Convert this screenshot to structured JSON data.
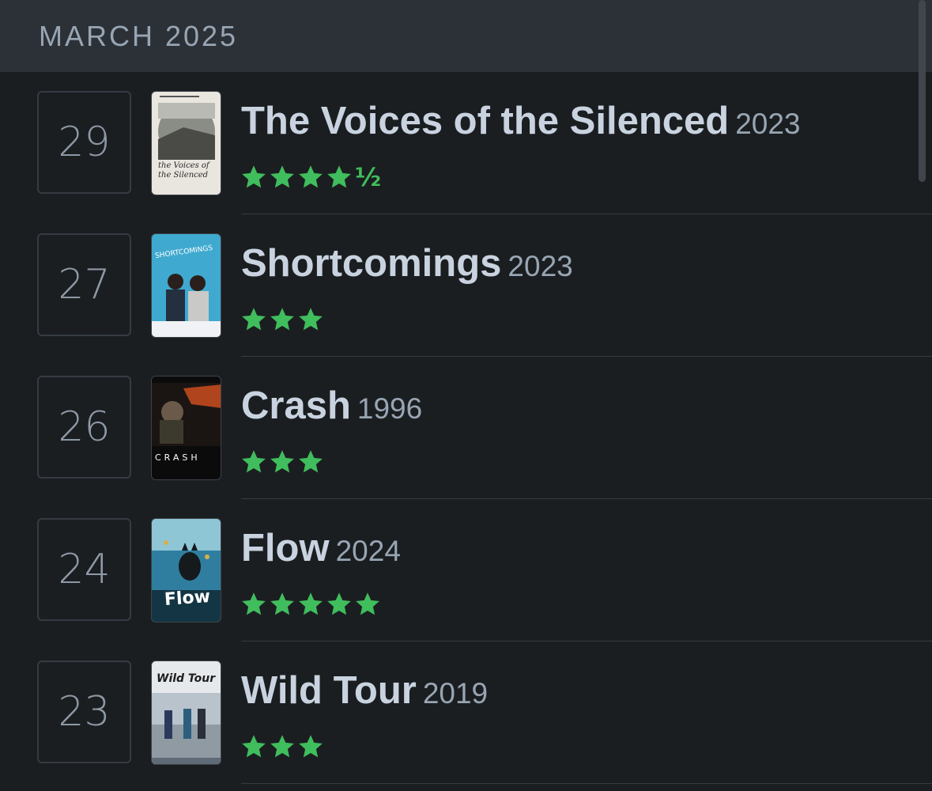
{
  "header": {
    "title": "MARCH 2025"
  },
  "accent": "#40bd5c",
  "entries": [
    {
      "day": "29",
      "title": "The Voices of the Silenced",
      "year": "2023",
      "stars": 4,
      "half": "½",
      "poster_text": "the Voices of the Silenced"
    },
    {
      "day": "27",
      "title": "Shortcomings",
      "year": "2023",
      "stars": 3,
      "half": "",
      "poster_text": "SHORTCOMINGS"
    },
    {
      "day": "26",
      "title": "Crash",
      "year": "1996",
      "stars": 3,
      "half": "",
      "poster_text": "CRASH"
    },
    {
      "day": "24",
      "title": "Flow",
      "year": "2024",
      "stars": 5,
      "half": "",
      "poster_text": "Flow"
    },
    {
      "day": "23",
      "title": "Wild Tour",
      "year": "2019",
      "stars": 3,
      "half": "",
      "poster_text": "Wild Tour"
    }
  ]
}
